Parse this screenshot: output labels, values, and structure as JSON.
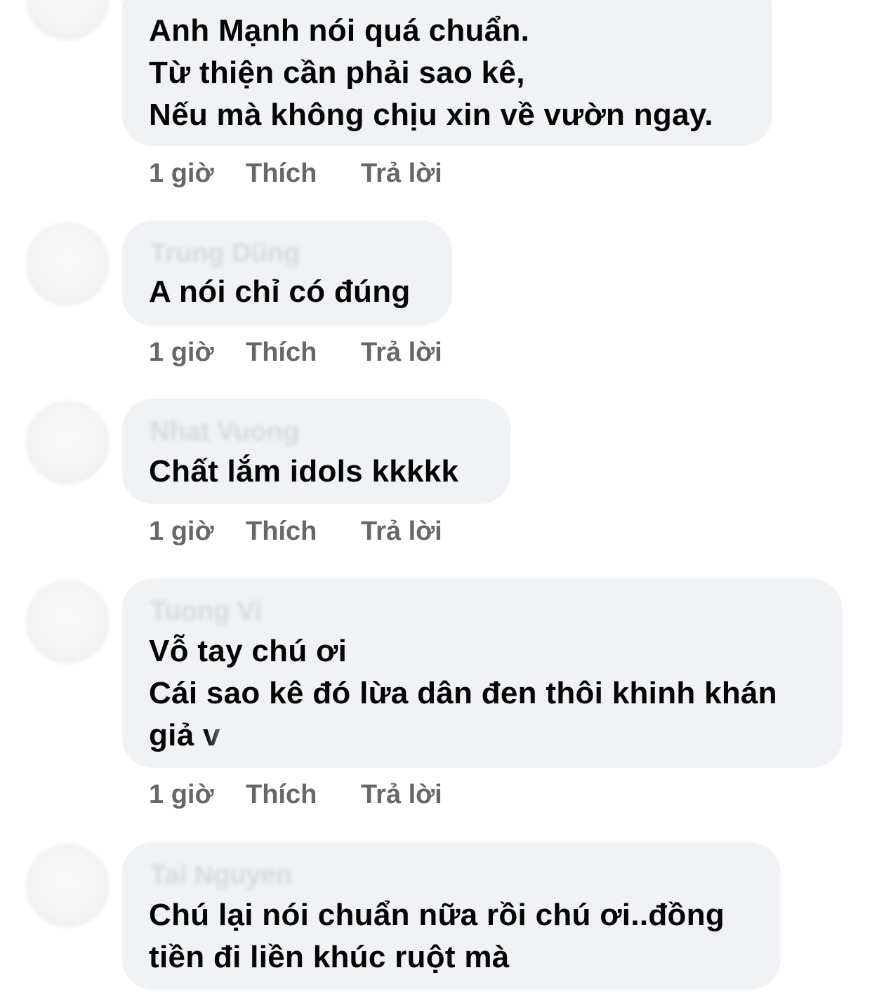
{
  "comments": [
    {
      "author": "",
      "lines": [
        "Anh Mạnh nói quá chuẩn.",
        "Từ thiện cần phải sao kê,",
        "Nếu mà không chịu xin về vườn ngay."
      ],
      "time": "1 giờ",
      "like_label": "Thích",
      "reply_label": "Trả lời"
    },
    {
      "author": "Trung Dũng",
      "lines": [
        "A nói chỉ có đúng"
      ],
      "time": "1 giờ",
      "like_label": "Thích",
      "reply_label": "Trả lời"
    },
    {
      "author": "Nhat Vuong",
      "lines": [
        "Chất lắm idols kkkkk"
      ],
      "time": "1 giờ",
      "like_label": "Thích",
      "reply_label": "Trả lời"
    },
    {
      "author": "Tuong Vi",
      "lines": [
        "Vỗ tay chú ơi",
        "Cái sao kê đó lừa dân đen thôi khinh khán",
        "giả v"
      ],
      "time": "1 giờ",
      "like_label": "Thích",
      "reply_label": "Trả lời"
    },
    {
      "author": "Tai Nguyen",
      "lines": [
        "Chú lại nói chuẩn nữa rồi chú ơi..đồng",
        "tiền đi liền khúc ruột mà"
      ]
    }
  ]
}
